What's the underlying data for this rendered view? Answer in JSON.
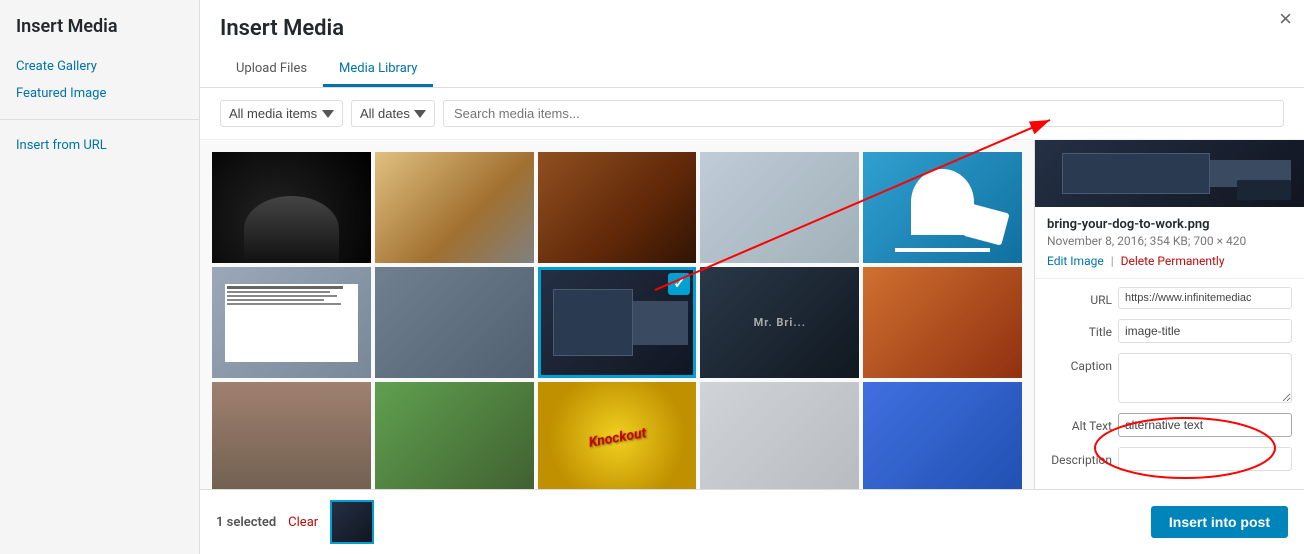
{
  "modal": {
    "title": "Insert Media",
    "close_label": "×"
  },
  "sidebar": {
    "title": "Insert Media",
    "links": [
      {
        "id": "create-gallery",
        "label": "Create Gallery"
      },
      {
        "id": "featured-image",
        "label": "Featured Image"
      },
      {
        "id": "insert-from-url",
        "label": "Insert from URL"
      }
    ]
  },
  "tabs": [
    {
      "id": "upload-files",
      "label": "Upload Files",
      "active": false
    },
    {
      "id": "media-library",
      "label": "Media Library",
      "active": true
    }
  ],
  "filters": {
    "media_items_label": "All media items",
    "dates_label": "All dates",
    "search_placeholder": "Search media items..."
  },
  "media_grid": {
    "items": [
      {
        "id": 1,
        "color": "#1a1a1a",
        "selected": false
      },
      {
        "id": 2,
        "color": "#c8a96e",
        "selected": false
      },
      {
        "id": 3,
        "color": "#8b6914",
        "selected": false
      },
      {
        "id": 4,
        "color": "#b0c4c8",
        "selected": false
      },
      {
        "id": 5,
        "color": "#2a9bd4",
        "selected": false
      },
      {
        "id": 6,
        "color": "#8898a0",
        "selected": false
      },
      {
        "id": 7,
        "color": "#5a6a72",
        "selected": false
      },
      {
        "id": 8,
        "color": "#1a2a3a",
        "selected": true
      },
      {
        "id": 9,
        "color": "#2a3040",
        "selected": false
      },
      {
        "id": 10,
        "color": "#c06020",
        "selected": false
      },
      {
        "id": 11,
        "color": "#8070a0",
        "selected": false
      },
      {
        "id": 12,
        "color": "#507040",
        "selected": false
      },
      {
        "id": 13,
        "color": "#e0c030",
        "selected": false
      },
      {
        "id": 14,
        "color": "#d0d8e0",
        "selected": false
      },
      {
        "id": 15,
        "color": "#3060d0",
        "selected": false
      }
    ]
  },
  "attachment": {
    "filename": "bring-your-dog-to-work.png",
    "meta": "November 8, 2016; 354 KB; 700 × 420",
    "edit_label": "Edit Image",
    "delete_label": "Delete Permanently",
    "url_label": "URL",
    "url_value": "https://www.infinitemediac",
    "title_label": "Title",
    "title_value": "image-title",
    "caption_label": "Caption",
    "caption_value": "",
    "alt_text_label": "Alt Text",
    "alt_text_value": "alternative text",
    "description_label": "Description",
    "description_value": ""
  },
  "bottom_bar": {
    "selected_count": "1 selected",
    "clear_label": "Clear",
    "insert_button_label": "Insert into post"
  },
  "colors": {
    "accent": "#0073aa",
    "selected_border": "#00a0d2",
    "delete": "#bc0b0b"
  }
}
